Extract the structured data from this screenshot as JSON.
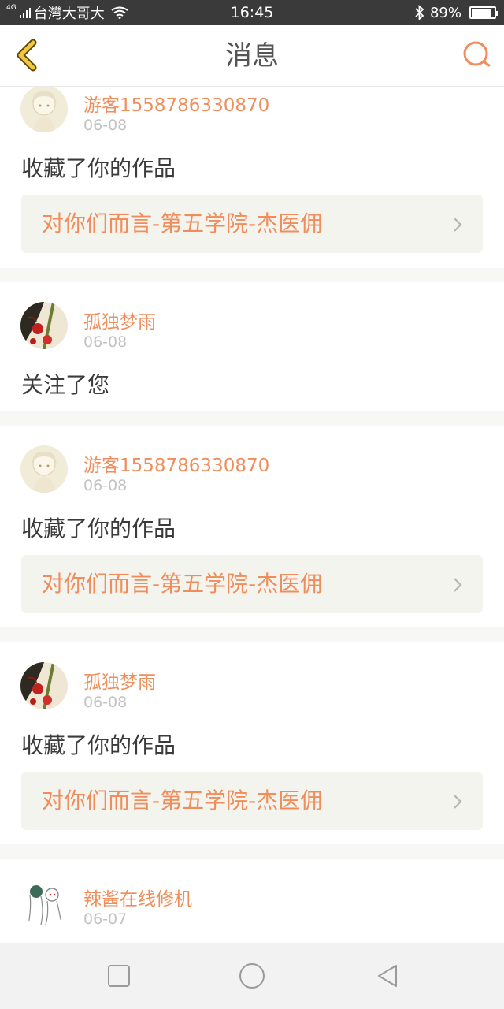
{
  "status_bar": {
    "network": "4G",
    "carrier": "台灣大哥大",
    "time": "16:45",
    "battery": "89%",
    "battery_level": 0.89
  },
  "header": {
    "title": "消息",
    "back_icon": "chevron-left-icon",
    "search_icon": "search-icon"
  },
  "messages": [
    {
      "user": "游客1558786330870",
      "date": "06-08",
      "action": "收藏了你的作品",
      "work": "对你们而言-第五学院-杰医佣",
      "avatar": "girl-avatar"
    },
    {
      "user": "孤独梦雨",
      "date": "06-08",
      "action": "关注了您",
      "avatar": "red-flower-avatar"
    },
    {
      "user": "游客1558786330870",
      "date": "06-08",
      "action": "收藏了你的作品",
      "work": "对你们而言-第五学院-杰医佣",
      "avatar": "girl-avatar"
    },
    {
      "user": "孤独梦雨",
      "date": "06-08",
      "action": "收藏了你的作品",
      "work": "对你们而言-第五学院-杰医佣",
      "avatar": "red-flower-avatar"
    },
    {
      "user": "辣酱在线修机",
      "date": "06-07",
      "avatar": "sketch-avatar"
    }
  ],
  "nav_bar": {
    "recents_icon": "square-icon",
    "home_icon": "circle-icon",
    "back_icon": "triangle-back-icon"
  },
  "colors": {
    "accent": "#ef8e5c",
    "back_accent": "#f5c542",
    "card_link_bg": "#f4f4ee",
    "divider": "#f7f7f5"
  }
}
